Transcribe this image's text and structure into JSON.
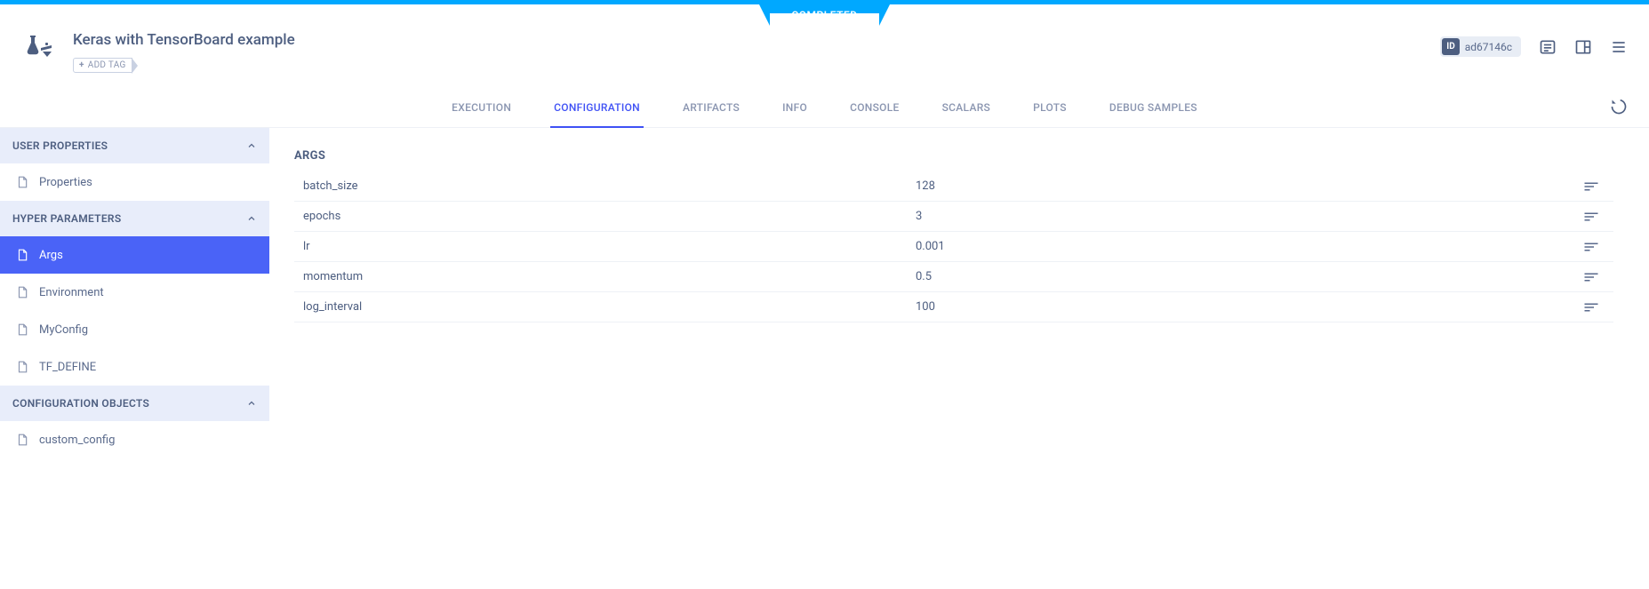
{
  "status": "COMPLETED",
  "title": "Keras with TensorBoard example",
  "add_tag_label": "ADD TAG",
  "id_badge": {
    "label": "ID",
    "value": "ad67146c"
  },
  "tabs": [
    {
      "label": "EXECUTION",
      "active": false
    },
    {
      "label": "CONFIGURATION",
      "active": true
    },
    {
      "label": "ARTIFACTS",
      "active": false
    },
    {
      "label": "INFO",
      "active": false
    },
    {
      "label": "CONSOLE",
      "active": false
    },
    {
      "label": "SCALARS",
      "active": false
    },
    {
      "label": "PLOTS",
      "active": false
    },
    {
      "label": "DEBUG SAMPLES",
      "active": false
    }
  ],
  "sidebar": {
    "groups": [
      {
        "title": "USER PROPERTIES",
        "items": [
          {
            "label": "Properties",
            "active": false
          }
        ]
      },
      {
        "title": "HYPER PARAMETERS",
        "items": [
          {
            "label": "Args",
            "active": true
          },
          {
            "label": "Environment",
            "active": false
          },
          {
            "label": "MyConfig",
            "active": false
          },
          {
            "label": "TF_DEFINE",
            "active": false
          }
        ]
      },
      {
        "title": "CONFIGURATION OBJECTS",
        "items": [
          {
            "label": "custom_config",
            "active": false
          }
        ]
      }
    ]
  },
  "content": {
    "section_title": "ARGS",
    "params": [
      {
        "key": "batch_size",
        "value": "128"
      },
      {
        "key": "epochs",
        "value": "3"
      },
      {
        "key": "lr",
        "value": "0.001"
      },
      {
        "key": "momentum",
        "value": "0.5"
      },
      {
        "key": "log_interval",
        "value": "100"
      }
    ]
  }
}
